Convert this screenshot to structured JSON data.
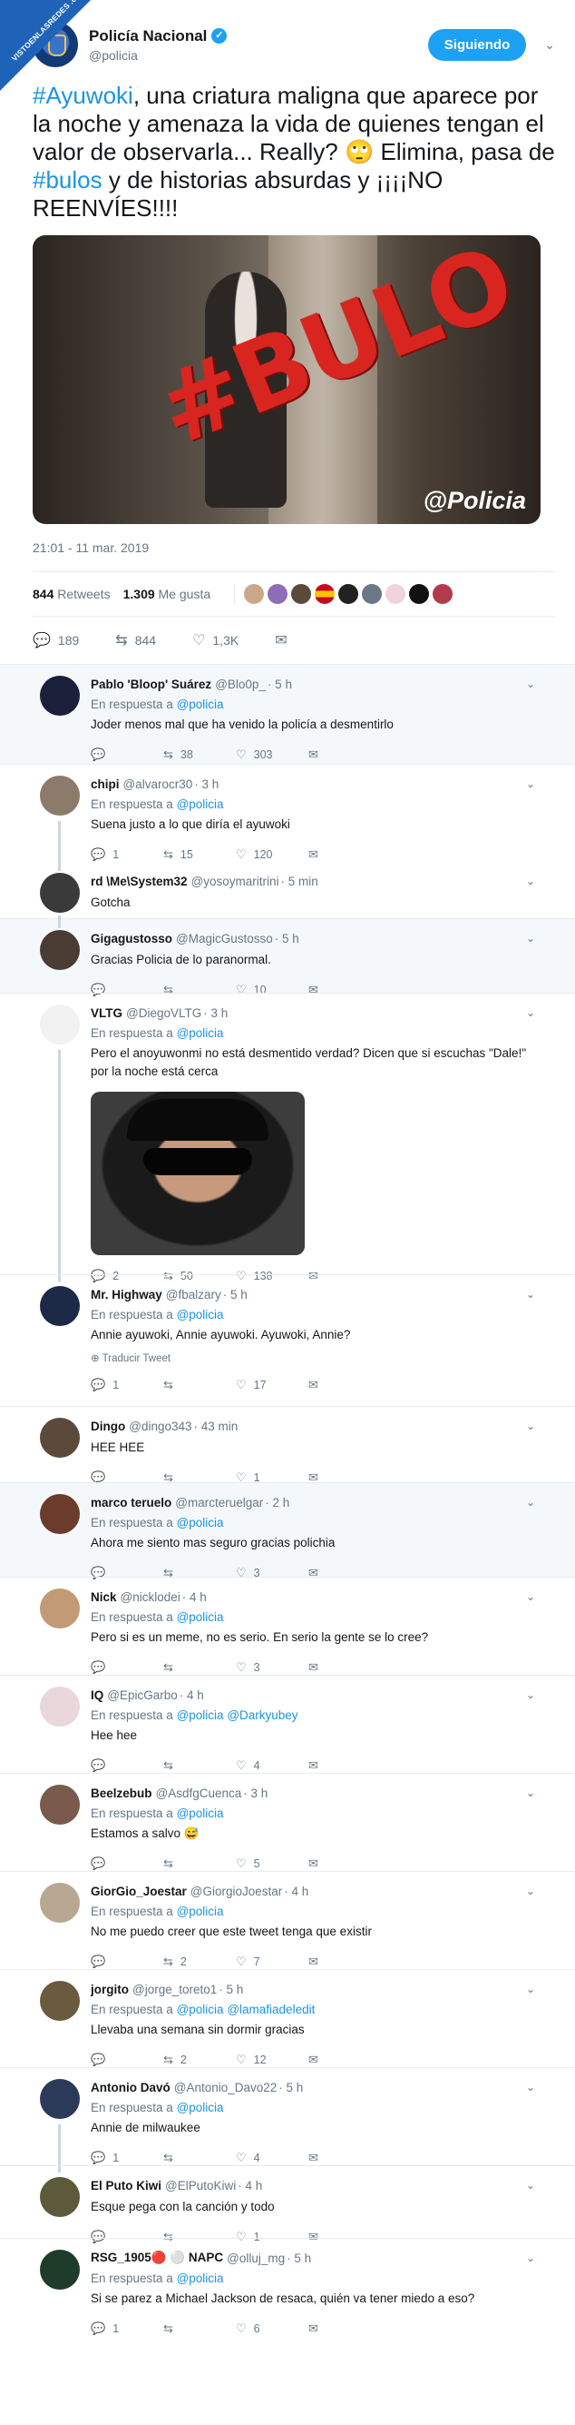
{
  "watermark": "VISTOENLASREDES .com",
  "colors": {
    "accent": "#1da1f2",
    "link": "#1b95e0",
    "muted": "#657786",
    "bulo_red": "#d8251f"
  },
  "main": {
    "name": "Policía Nacional",
    "handle": "@policia",
    "follow_label": "Siguiendo",
    "text_hash1": "#Ayuwoki",
    "text_part1": ", una criatura maligna que aparece por la noche y amenaza la vida de quienes tengan el valor de observarla... Really? 🙄 Elimina, pasa de ",
    "text_hash2": "#bulos",
    "text_part2": " y de historias absurdas y ¡¡¡¡NO REENVÍES!!!!",
    "media_text": "#BULO",
    "media_brand": "@Policia",
    "timestamp": "21:01 - 11 mar. 2019",
    "retweets_count": "844",
    "retweets_label": "Retweets",
    "likes_count": "1.309",
    "likes_label": "Me gusta",
    "actions": {
      "replies": "189",
      "retweets": "844",
      "likes": "1,3K"
    }
  },
  "icons": {
    "reply": "reply-icon",
    "retweet": "retweet-icon",
    "like": "heart-icon",
    "dm": "envelope-icon",
    "chevron": "chevron-down-icon",
    "verified": "verified-icon",
    "globe": "globe-icon"
  },
  "reply_to_label": "En respuesta a",
  "translate_label": "Traducir Tweet",
  "replies": [
    {
      "name": "Pablo 'Bloop' Suárez",
      "handle": "@Blo0p_",
      "time": "· 5 h",
      "reply_to": "@policia",
      "text": "Joder menos mal que ha venido la policía a desmentirlo",
      "replies": "",
      "retweets": "38",
      "likes": "303"
    },
    {
      "name": "chipi",
      "handle": "@alvarocr30",
      "time": "· 3 h",
      "reply_to": "@policia",
      "text": "Suena justo a lo que diría el ayuwoki",
      "replies": "1",
      "retweets": "15",
      "likes": "120"
    },
    {
      "name": "rd \\Me\\System32",
      "handle": "@yosoymaritrini",
      "time": "· 5 min",
      "text": "Gotcha",
      "replies": "",
      "retweets": "",
      "likes": ""
    },
    {
      "name": "Gigagustosso",
      "handle": "@MagicGustosso",
      "time": "· 5 h",
      "text": "Gracias Policia de lo paranormal.",
      "replies": "",
      "retweets": "",
      "likes": "10"
    },
    {
      "name": "VLTG",
      "handle": "@DiegoVLTG",
      "time": "· 3 h",
      "reply_to": "@policia",
      "text": "Pero el anoyuwonmi no está desmentido verdad? Dicen que si escuchas \"Dale!\" por la noche está cerca",
      "replies": "2",
      "retweets": "50",
      "likes": "138"
    },
    {
      "name": "Mr. Highway",
      "handle": "@fbalzary",
      "time": "· 5 h",
      "reply_to": "@policia",
      "text": "Annie ayuwoki, Annie ayuwoki. Ayuwoki, Annie?",
      "replies": "1",
      "retweets": "",
      "likes": "17"
    },
    {
      "name": "Dingo",
      "handle": "@dingo343",
      "time": "· 43 min",
      "text": "HEE HEE",
      "replies": "",
      "retweets": "",
      "likes": "1"
    },
    {
      "name": "marco teruelo",
      "handle": "@marcteruelgar",
      "time": "· 2 h",
      "reply_to": "@policia",
      "text": "Ahora me siento mas seguro gracias polichia",
      "replies": "",
      "retweets": "",
      "likes": "3"
    },
    {
      "name": "Nick",
      "handle": "@nicklodei",
      "time": "· 4 h",
      "reply_to": "@policia",
      "text": "Pero si es un meme, no es serio. En serio la gente se lo cree?",
      "replies": "",
      "retweets": "",
      "likes": "3"
    },
    {
      "name": "IQ",
      "handle": "@EpicGarbo",
      "time": "· 4 h",
      "reply_to": "@policia",
      "reply_to2": "@Darkyubey",
      "text": "Hee hee",
      "replies": "",
      "retweets": "",
      "likes": "4"
    },
    {
      "name": "Beelzebub",
      "handle": "@AsdfgCuenca",
      "time": "· 3 h",
      "reply_to": "@policia",
      "text": "Estamos a salvo 😅",
      "replies": "",
      "retweets": "",
      "likes": "5"
    },
    {
      "name": "GiorGio_Joestar",
      "handle": "@GiorgioJoestar",
      "time": "· 4 h",
      "reply_to": "@policia",
      "text": "No me puedo creer que este tweet tenga que existir",
      "replies": "",
      "retweets": "2",
      "likes": "7"
    },
    {
      "name": "jorgito",
      "handle": "@jorge_toreto1",
      "time": "· 5 h",
      "reply_to": "@policia",
      "reply_to2": "@lamafiadeledit",
      "text": "Llevaba una semana sin dormir gracias",
      "replies": "",
      "retweets": "2",
      "likes": "12"
    },
    {
      "name": "Antonio Davó",
      "handle": "@Antonio_Davo22",
      "time": "· 5 h",
      "reply_to": "@policia",
      "text": "Annie de milwaukee",
      "replies": "1",
      "retweets": "",
      "likes": "4"
    },
    {
      "name": "El Puto Kiwi",
      "handle": "@ElPutoKiwi",
      "time": "· 4 h",
      "text": "Esque pega con la canción y todo",
      "replies": "",
      "retweets": "",
      "likes": "1"
    },
    {
      "name": "RSG_1905🔴 ⚪ NAPC",
      "handle": "@olluj_mg",
      "time": "· 5 h",
      "reply_to": "@policia",
      "text": "Si se parez a Michael Jackson de resaca, quién va tener miedo a eso?",
      "replies": "1",
      "retweets": "",
      "likes": "6"
    }
  ]
}
